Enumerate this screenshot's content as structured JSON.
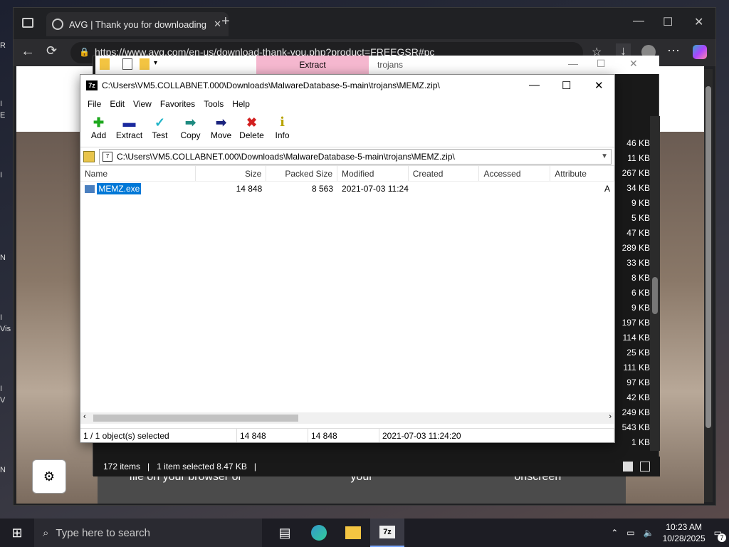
{
  "browser": {
    "tab_title": "AVG | Thank you for downloading",
    "url": "https://www.avg.com/en-us/download-thank-you.php?product=FREEGSR#pc",
    "new_tab_icon": "plus-icon"
  },
  "desktop_edge": [
    "R",
    "I",
    "E",
    "I",
    "N",
    "I",
    "Vis",
    "I",
    "V",
    "N"
  ],
  "sevenzip_ribbon": {
    "extract_label": "Extract",
    "trojans_label": "trojans"
  },
  "sevenzip": {
    "title": "C:\\Users\\VM5.COLLABNET.000\\Downloads\\MalwareDatabase-5-main\\trojans\\MEMZ.zip\\",
    "menu": [
      "File",
      "Edit",
      "View",
      "Favorites",
      "Tools",
      "Help"
    ],
    "toolbar": [
      {
        "label": "Add",
        "icon": "add-icon",
        "glyph": "✚",
        "color": "#1ea81e"
      },
      {
        "label": "Extract",
        "icon": "extract-icon",
        "glyph": "▬",
        "color": "#1a2a9e"
      },
      {
        "label": "Test",
        "icon": "test-icon",
        "glyph": "✓",
        "color": "#1fb4c7"
      },
      {
        "label": "Copy",
        "icon": "copy-icon",
        "glyph": "➡",
        "color": "#1d8a80"
      },
      {
        "label": "Move",
        "icon": "move-icon",
        "glyph": "➡",
        "color": "#1a237e"
      },
      {
        "label": "Delete",
        "icon": "delete-icon",
        "glyph": "✖",
        "color": "#d32020"
      },
      {
        "label": "Info",
        "icon": "info-icon",
        "glyph": "i",
        "color": "#b8a400"
      }
    ],
    "path": "C:\\Users\\VM5.COLLABNET.000\\Downloads\\MalwareDatabase-5-main\\trojans\\MEMZ.zip\\",
    "columns": [
      "Name",
      "Size",
      "Packed Size",
      "Modified",
      "Created",
      "Accessed",
      "Attribute"
    ],
    "rows": [
      {
        "name": "MEMZ.exe",
        "size": "14 848",
        "packed": "8 563",
        "modified": "2021-07-03 11:24",
        "created": "",
        "accessed": "",
        "attr": "A"
      }
    ],
    "status": {
      "selected": "1 / 1 object(s) selected",
      "size": "14 848",
      "packed": "14 848",
      "date": "2021-07-03 11:24:20"
    }
  },
  "explorer": {
    "sizes": [
      "46 KB",
      "11 KB",
      "267 KB",
      "34 KB",
      "9 KB",
      "5 KB",
      "47 KB",
      "289 KB",
      "33 KB",
      "8 KB",
      "6 KB",
      "9 KB",
      "197 KB",
      "114 KB",
      "25 KB",
      "111 KB",
      "97 KB",
      "42 KB",
      "249 KB",
      "543 KB",
      "1 KB"
    ],
    "items_count": "172 items",
    "selection": "1 item selected  8.47 KB"
  },
  "avg_page": {
    "col1": "file on your browser or",
    "col2": "your",
    "col3": "onscreen"
  },
  "taskbar": {
    "search_placeholder": "Type here to search",
    "time": "10:23 AM",
    "date": "10/28/2025",
    "notif_count": "7"
  }
}
